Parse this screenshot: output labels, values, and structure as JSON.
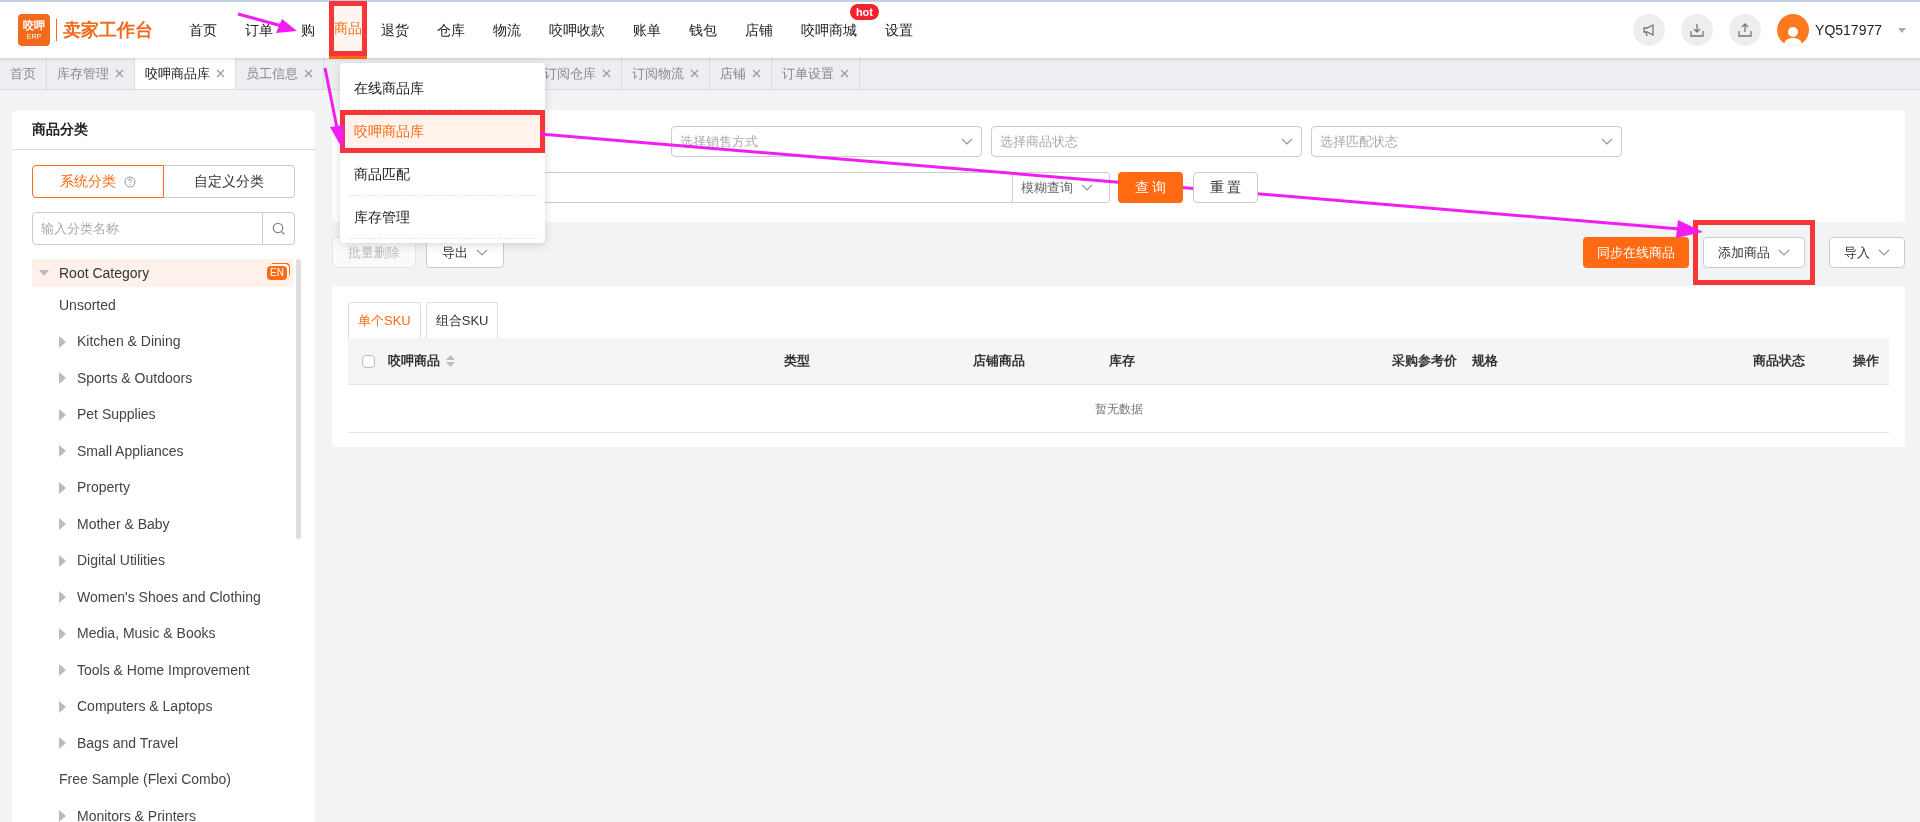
{
  "header": {
    "logo": {
      "mark": "咬呷",
      "sub": "ERP",
      "title": "卖家工作台"
    },
    "nav": [
      {
        "label": "首页",
        "selected": false
      },
      {
        "label": "订单",
        "selected": false
      },
      {
        "label": "购",
        "selected": false
      },
      {
        "label": "商品",
        "selected": true
      },
      {
        "label": "退货",
        "selected": false
      },
      {
        "label": "仓库",
        "selected": false
      },
      {
        "label": "物流",
        "selected": false
      },
      {
        "label": "咬呷收款",
        "selected": false
      },
      {
        "label": "账单",
        "selected": false
      },
      {
        "label": "钱包",
        "selected": false
      },
      {
        "label": "店铺",
        "selected": false
      },
      {
        "label": "咬呷商城",
        "selected": false,
        "badge": "hot"
      },
      {
        "label": "设置",
        "selected": false
      }
    ],
    "user": "YQ517977"
  },
  "page_tabs": [
    {
      "label": "首页",
      "selected": false,
      "closable": false
    },
    {
      "label": "库存管理",
      "selected": false,
      "closable": true
    },
    {
      "label": "咬呷商品库",
      "selected": true,
      "closable": true
    },
    {
      "label": "员工信息",
      "selected": false,
      "closable": true
    },
    {
      "kind": "hidden"
    },
    {
      "label": "订阅仓库",
      "selected": false,
      "closable": true
    },
    {
      "label": "订阅物流",
      "selected": false,
      "closable": true
    },
    {
      "label": "店铺",
      "selected": false,
      "closable": true
    },
    {
      "label": "订单设置",
      "selected": false,
      "closable": true
    }
  ],
  "menu": [
    {
      "label": "在线商品库",
      "selected": false
    },
    {
      "label": "咬呷商品库",
      "selected": true
    },
    {
      "label": "商品匹配",
      "selected": false
    },
    {
      "label": "库存管理",
      "selected": false
    }
  ],
  "sidebar": {
    "title": "商品分类",
    "segments": [
      {
        "label": "系统分类",
        "selected": true,
        "help": true
      },
      {
        "label": "自定义分类",
        "selected": false,
        "help": false
      }
    ],
    "search": {
      "placeholder": "输入分类名称"
    },
    "tree": [
      {
        "label": "Root Category",
        "expanded": true,
        "badge": "EN",
        "children": [
          {
            "label": "Unsorted",
            "kind": "leaf"
          },
          {
            "label": "Kitchen & Dining",
            "kind": "folder"
          },
          {
            "label": "Sports & Outdoors",
            "kind": "folder"
          },
          {
            "label": "Pet Supplies",
            "kind": "folder"
          },
          {
            "label": "Small Appliances",
            "kind": "folder"
          },
          {
            "label": "Property",
            "kind": "folder"
          },
          {
            "label": "Mother & Baby",
            "kind": "folder"
          },
          {
            "label": "Digital Utilities",
            "kind": "folder"
          },
          {
            "label": "Women's Shoes and Clothing",
            "kind": "folder"
          },
          {
            "label": "Media, Music & Books",
            "kind": "folder"
          },
          {
            "label": "Tools & Home Improvement",
            "kind": "folder"
          },
          {
            "label": "Computers & Laptops",
            "kind": "folder"
          },
          {
            "label": "Bags and Travel",
            "kind": "folder"
          },
          {
            "label": "Free Sample (Flexi Combo)",
            "kind": "leaf"
          },
          {
            "label": "Monitors & Printers",
            "kind": "folder"
          }
        ]
      }
    ]
  },
  "filters": {
    "selects": [
      {
        "kind": "covered"
      },
      {
        "placeholder": "选择销售方式"
      },
      {
        "placeholder": "选择商品状态"
      },
      {
        "placeholder": "选择匹配状态"
      }
    ],
    "search_mode": "模糊查询",
    "query_button": "查 询",
    "reset_button": "重 置"
  },
  "toolbar": {
    "left": [
      {
        "label": "批量删除",
        "disabled": true,
        "dropdown": false
      },
      {
        "label": "导出",
        "disabled": false,
        "dropdown": true
      }
    ],
    "right": [
      {
        "label": "同步在线商品",
        "kind": "primary",
        "annotated": false
      },
      {
        "label": "添加商品",
        "kind": "dropdown",
        "annotated": true
      },
      {
        "label": "导入",
        "kind": "dropdown",
        "annotated": false
      }
    ]
  },
  "table": {
    "tabs": [
      {
        "label": "单个SKU",
        "selected": true
      },
      {
        "label": "组合SKU",
        "selected": false
      }
    ],
    "select_all": {
      "checked": false
    },
    "columns": [
      "咬呷商品",
      "类型",
      "店铺商品",
      "库存",
      "采购参考价",
      "规格",
      "商品状态",
      "操作"
    ],
    "empty": "暂无数据"
  }
}
